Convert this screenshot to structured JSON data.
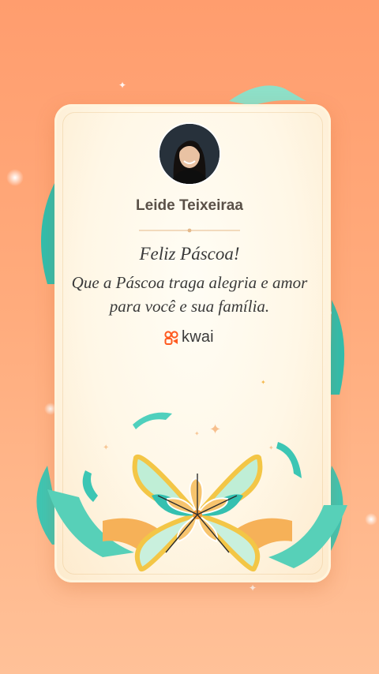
{
  "card": {
    "author_name": "Leide Teixeiraa",
    "greeting_title": "Feliz Páscoa!",
    "greeting_message": "Que a Páscoa traga alegria e amor para você e sua família."
  },
  "brand": {
    "name": "kwai",
    "icon": "kwai-logo-icon",
    "color": "#ff5a1f"
  },
  "colors": {
    "background_top": "#ff9d6e",
    "background_bottom": "#ffc198",
    "card": "#fff7e6",
    "ribbon_teal": "#35c4b4",
    "petal_yellow": "#f8d34a",
    "petal_orange": "#f5a04a"
  }
}
